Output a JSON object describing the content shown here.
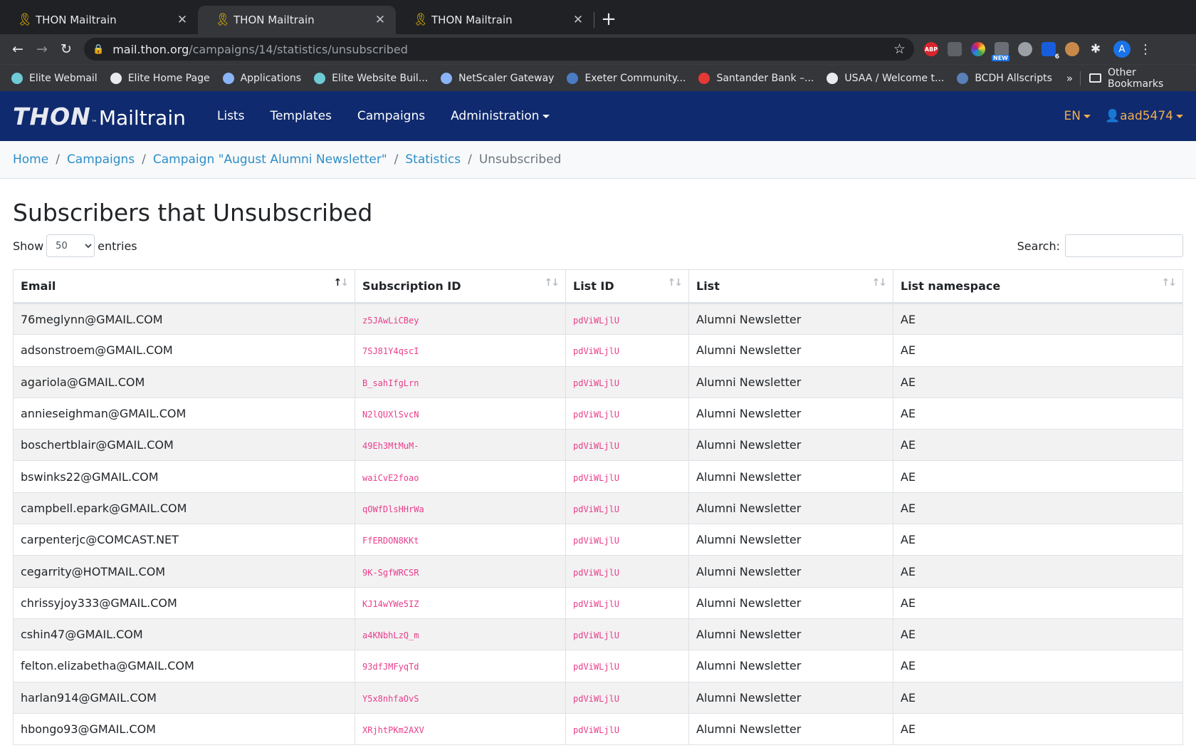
{
  "browser": {
    "tabs": [
      {
        "title": "THON Mailtrain"
      },
      {
        "title": "THON Mailtrain"
      },
      {
        "title": "THON Mailtrain"
      }
    ],
    "url_host": "mail.thon.org",
    "url_path": "/campaigns/14/statistics/unsubscribed",
    "extension_new_badge": "NEW",
    "extension_count_badge": "6",
    "profile_initial": "A",
    "bookmarks": [
      {
        "label": "Elite Webmail",
        "color": "#6ecbd6"
      },
      {
        "label": "Elite Home Page",
        "color": "#e8eaed"
      },
      {
        "label": "Applications",
        "color": "#8ab4f8"
      },
      {
        "label": "Elite Website Buil...",
        "color": "#6ecbd6"
      },
      {
        "label": "NetScaler Gateway",
        "color": "#8ab4f8"
      },
      {
        "label": "Exeter Community...",
        "color": "#4a7cc4"
      },
      {
        "label": "Santander Bank –...",
        "color": "#e53935"
      },
      {
        "label": "USAA / Welcome t...",
        "color": "#e8eaed"
      },
      {
        "label": "BCDH Allscripts",
        "color": "#5b7fb8"
      }
    ],
    "bookmarks_more": "»",
    "other_bookmarks": "Other Bookmarks"
  },
  "app": {
    "brand_thon": "THON",
    "brand_mailtrain": "Mailtrain",
    "nav": {
      "lists": "Lists",
      "templates": "Templates",
      "campaigns": "Campaigns",
      "administration": "Administration"
    },
    "lang": "EN",
    "user": "aad5474",
    "nav_bg_color": "#0f2a6e",
    "accent_color": "#f0ad4e"
  },
  "breadcrumb": {
    "home": "Home",
    "campaigns": "Campaigns",
    "campaign": "Campaign \"August Alumni Newsletter\"",
    "statistics": "Statistics",
    "current": "Unsubscribed"
  },
  "page": {
    "title": "Subscribers that Unsubscribed",
    "show_label": "Show",
    "entries_value": "50",
    "entries_label": "entries",
    "search_label": "Search:"
  },
  "table": {
    "columns": [
      "Email",
      "Subscription ID",
      "List ID",
      "List",
      "List namespace"
    ],
    "rows": [
      {
        "email": "76meglynn@GMAIL.COM",
        "cid": "z5JAwLiCBey",
        "list_id": "pdViWLjlU",
        "list": "Alumni Newsletter",
        "ns": "AE"
      },
      {
        "email": "adsonstroem@GMAIL.COM",
        "cid": "7SJ81Y4qscI",
        "list_id": "pdViWLjlU",
        "list": "Alumni Newsletter",
        "ns": "AE"
      },
      {
        "email": "agariola@GMAIL.COM",
        "cid": "B_sahIfgLrn",
        "list_id": "pdViWLjlU",
        "list": "Alumni Newsletter",
        "ns": "AE"
      },
      {
        "email": "annieseighman@GMAIL.COM",
        "cid": "N2lQUXlSvcN",
        "list_id": "pdViWLjlU",
        "list": "Alumni Newsletter",
        "ns": "AE"
      },
      {
        "email": "boschertblair@GMAIL.COM",
        "cid": "49Eh3MtMuM-",
        "list_id": "pdViWLjlU",
        "list": "Alumni Newsletter",
        "ns": "AE"
      },
      {
        "email": "bswinks22@GMAIL.COM",
        "cid": "waiCvE2foao",
        "list_id": "pdViWLjlU",
        "list": "Alumni Newsletter",
        "ns": "AE"
      },
      {
        "email": "campbell.epark@GMAIL.COM",
        "cid": "qOWfDlsHHrWa",
        "list_id": "pdViWLjlU",
        "list": "Alumni Newsletter",
        "ns": "AE"
      },
      {
        "email": "carpenterjc@COMCAST.NET",
        "cid": "FfERDON8KKt",
        "list_id": "pdViWLjlU",
        "list": "Alumni Newsletter",
        "ns": "AE"
      },
      {
        "email": "cegarrity@HOTMAIL.COM",
        "cid": "9K-SgfWRCSR",
        "list_id": "pdViWLjlU",
        "list": "Alumni Newsletter",
        "ns": "AE"
      },
      {
        "email": "chrissyjoy333@GMAIL.COM",
        "cid": "KJ14wYWe5IZ",
        "list_id": "pdViWLjlU",
        "list": "Alumni Newsletter",
        "ns": "AE"
      },
      {
        "email": "cshin47@GMAIL.COM",
        "cid": "a4KNbhLzQ_m",
        "list_id": "pdViWLjlU",
        "list": "Alumni Newsletter",
        "ns": "AE"
      },
      {
        "email": "felton.elizabetha@GMAIL.COM",
        "cid": "93dfJMFyqTd",
        "list_id": "pdViWLjlU",
        "list": "Alumni Newsletter",
        "ns": "AE"
      },
      {
        "email": "harlan914@GMAIL.COM",
        "cid": "Y5x8nhfaOvS",
        "list_id": "pdViWLjlU",
        "list": "Alumni Newsletter",
        "ns": "AE"
      },
      {
        "email": "hbongo93@GMAIL.COM",
        "cid": "XRjhtPKm2AXV",
        "list_id": "pdViWLjlU",
        "list": "Alumni Newsletter",
        "ns": "AE"
      }
    ]
  }
}
